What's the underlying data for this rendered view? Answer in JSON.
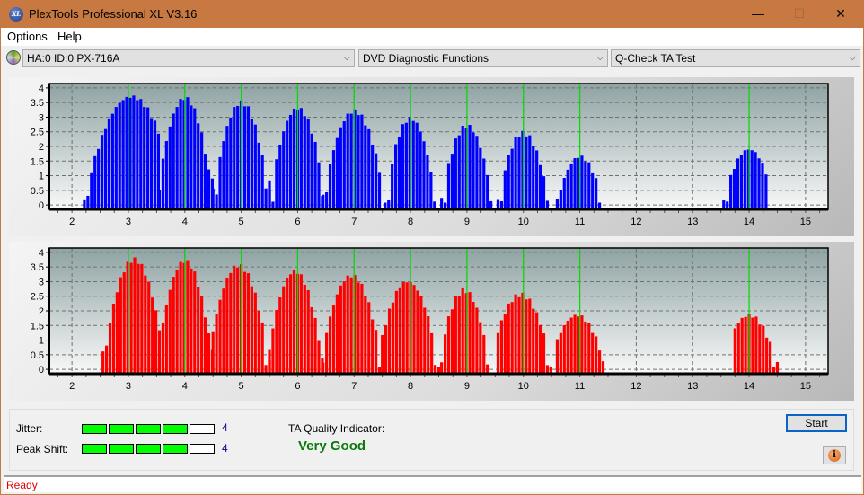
{
  "window": {
    "title": "PlexTools Professional XL V3.16",
    "app_icon_label": "XL",
    "controls": {
      "minimize": "—",
      "maximize": "☐",
      "close": "✕"
    }
  },
  "menu": [
    {
      "label": "Options"
    },
    {
      "label": "Help"
    }
  ],
  "toolbar": {
    "drive_select": "HA:0 ID:0  PX-716A",
    "function_select": "DVD Diagnostic Functions",
    "test_select": "Q-Check TA Test",
    "chevron": "⌵"
  },
  "colors": {
    "jitter_bars": "#0000ff",
    "peak_bars": "#ff0000",
    "marker_lines": "#00dd00",
    "meter_on": "#00ff00",
    "quality_text": "#0a7a0a",
    "status_text": "#e00000",
    "titlebar": "#c87941"
  },
  "chart_data": [
    {
      "type": "bar",
      "name": "jitter-histogram",
      "title": "",
      "xlabel": "",
      "ylabel": "",
      "xlim": [
        1.6,
        15.4
      ],
      "ylim": [
        -0.15,
        4.15
      ],
      "x_ticks": [
        2,
        3,
        4,
        5,
        6,
        7,
        8,
        9,
        10,
        11,
        12,
        13,
        14,
        15
      ],
      "y_ticks": [
        "0",
        "0.5",
        "1",
        "1.5",
        "2",
        "2.5",
        "3",
        "3.5",
        "4"
      ],
      "markers": [
        3,
        4,
        5,
        6,
        7,
        8,
        9,
        10,
        11,
        14
      ],
      "grid": true,
      "bar_color": "#0000ff",
      "peaks": [
        {
          "center": 3.05,
          "height": 3.7,
          "min": 2.22,
          "max": 3.55,
          "base": 0.3
        },
        {
          "center": 4.0,
          "height": 3.65,
          "min": 3.55,
          "max": 4.5,
          "base": 1.2
        },
        {
          "center": 5.0,
          "height": 3.5,
          "min": 4.5,
          "max": 5.5,
          "base": 0.9
        },
        {
          "center": 6.0,
          "height": 3.3,
          "min": 5.5,
          "max": 6.45,
          "base": 0.5
        },
        {
          "center": 7.0,
          "height": 3.2,
          "min": 6.45,
          "max": 7.5,
          "base": 0.5
        },
        {
          "center": 8.0,
          "height": 2.95,
          "min": 7.55,
          "max": 8.45,
          "base": 0.2
        },
        {
          "center": 9.0,
          "height": 2.7,
          "min": 8.55,
          "max": 9.45,
          "base": 0.2
        },
        {
          "center": 10.0,
          "height": 2.45,
          "min": 9.55,
          "max": 10.45,
          "base": 0.2
        },
        {
          "center": 11.0,
          "height": 1.65,
          "min": 10.6,
          "max": 11.35,
          "base": 0.2
        },
        {
          "center": 14.0,
          "height": 1.9,
          "min": 13.55,
          "max": 14.3,
          "base": 0.2
        }
      ]
    },
    {
      "type": "bar",
      "name": "peak-shift-histogram",
      "title": "",
      "xlabel": "",
      "ylabel": "",
      "xlim": [
        1.6,
        15.4
      ],
      "ylim": [
        -0.15,
        4.15
      ],
      "x_ticks": [
        2,
        3,
        4,
        5,
        6,
        7,
        8,
        9,
        10,
        11,
        12,
        13,
        14,
        15
      ],
      "y_ticks": [
        "0",
        "0.5",
        "1",
        "1.5",
        "2",
        "2.5",
        "3",
        "3.5",
        "4"
      ],
      "markers": [
        3,
        4,
        5,
        6,
        7,
        8,
        9,
        10,
        11,
        14
      ],
      "grid": true,
      "bar_color": "#ff0000",
      "peaks": [
        {
          "center": 3.1,
          "height": 3.75,
          "min": 2.55,
          "max": 3.55,
          "base": 0.9
        },
        {
          "center": 4.0,
          "height": 3.7,
          "min": 3.55,
          "max": 4.5,
          "base": 0.9
        },
        {
          "center": 4.95,
          "height": 3.55,
          "min": 4.5,
          "max": 5.5,
          "base": 0.3
        },
        {
          "center": 5.95,
          "height": 3.35,
          "min": 5.5,
          "max": 6.45,
          "base": 0.7
        },
        {
          "center": 6.95,
          "height": 3.2,
          "min": 6.45,
          "max": 7.5,
          "base": 0.3
        },
        {
          "center": 7.95,
          "height": 3.0,
          "min": 7.5,
          "max": 8.5,
          "base": 0.2
        },
        {
          "center": 8.95,
          "height": 2.7,
          "min": 8.55,
          "max": 9.4,
          "base": 0.2
        },
        {
          "center": 9.95,
          "height": 2.55,
          "min": 9.55,
          "max": 10.5,
          "base": 0.2
        },
        {
          "center": 10.95,
          "height": 1.85,
          "min": 10.6,
          "max": 11.45,
          "base": 0.2
        },
        {
          "center": 14.0,
          "height": 1.85,
          "min": 13.75,
          "max": 14.5,
          "base": 0.2
        }
      ]
    }
  ],
  "metrics": {
    "jitter": {
      "label": "Jitter:",
      "value": 4,
      "max": 5
    },
    "peak_shift": {
      "label": "Peak Shift:",
      "value": 4,
      "max": 5
    }
  },
  "quality": {
    "label": "TA Quality Indicator:",
    "value": "Very Good"
  },
  "buttons": {
    "start": "Start",
    "info": "i"
  },
  "status": {
    "text": "Ready"
  }
}
